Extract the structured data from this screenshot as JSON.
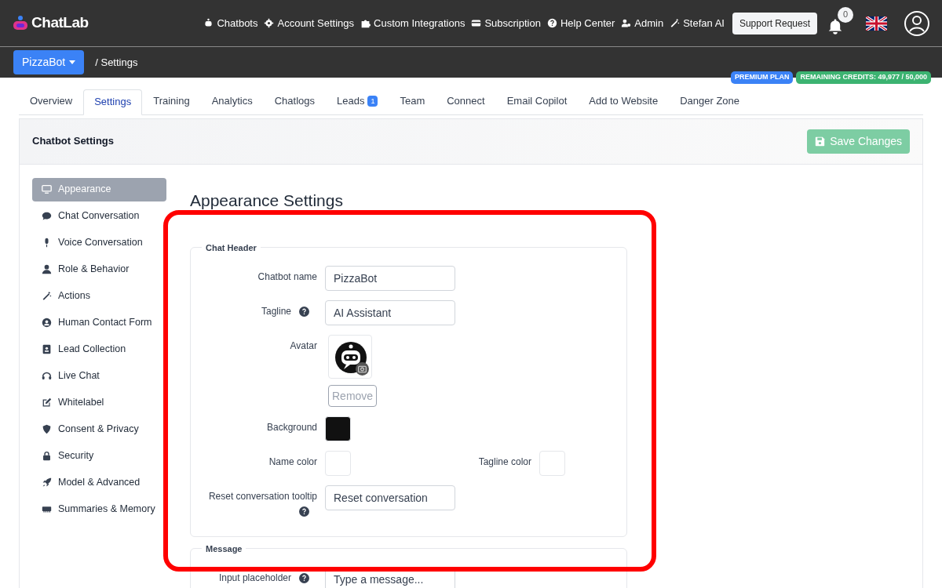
{
  "header": {
    "logo": "ChatLab",
    "nav": [
      {
        "label": "Chatbots",
        "kind": "robot"
      },
      {
        "label": "Account Settings",
        "kind": "gear"
      },
      {
        "label": "Custom Integrations",
        "kind": "puzzle"
      },
      {
        "label": "Subscription",
        "kind": "card"
      },
      {
        "label": "Help Center",
        "kind": "question"
      },
      {
        "label": "Admin",
        "kind": "user-gear"
      },
      {
        "label": "Stefan AI",
        "kind": "wand"
      }
    ],
    "support_button": "Support Request",
    "notification_count": "0"
  },
  "subbar": {
    "bot_selector": "PizzaBot",
    "breadcrumb": "/ Settings"
  },
  "badges": [
    {
      "label": "PREMIUM PLAN",
      "color": "#3b82f6"
    },
    {
      "label": "REMAINING CREDITS: 49,977 / 50,000",
      "color": "#3cb371"
    }
  ],
  "tabs": [
    {
      "label": "Overview",
      "selected": false
    },
    {
      "label": "Settings",
      "selected": true
    },
    {
      "label": "Training",
      "selected": false
    },
    {
      "label": "Analytics",
      "selected": false
    },
    {
      "label": "Chatlogs",
      "selected": false
    },
    {
      "label": "Leads",
      "selected": false,
      "count": "1"
    },
    {
      "label": "Team",
      "selected": false
    },
    {
      "label": "Connect",
      "selected": false
    },
    {
      "label": "Email Copilot",
      "selected": false
    },
    {
      "label": "Add to Website",
      "selected": false
    },
    {
      "label": "Danger Zone",
      "selected": false
    }
  ],
  "card": {
    "title": "Chatbot Settings",
    "save_button": {
      "label": "Save Changes",
      "disabled": true
    }
  },
  "sidebar": {
    "items": [
      {
        "label": "Appearance",
        "kind": "monitor",
        "selected": true
      },
      {
        "label": "Chat Conversation",
        "kind": "chat",
        "selected": false
      },
      {
        "label": "Voice Conversation",
        "kind": "mic",
        "selected": false
      },
      {
        "label": "Role & Behavior",
        "kind": "user",
        "selected": false
      },
      {
        "label": "Actions",
        "kind": "wand",
        "selected": false
      },
      {
        "label": "Human Contact Form",
        "kind": "user-circle",
        "selected": false
      },
      {
        "label": "Lead Collection",
        "kind": "contact-book",
        "selected": false
      },
      {
        "label": "Live Chat",
        "kind": "headset",
        "selected": false
      },
      {
        "label": "Whitelabel",
        "kind": "edit",
        "selected": false
      },
      {
        "label": "Consent & Privacy",
        "kind": "shield",
        "selected": false
      },
      {
        "label": "Security",
        "kind": "lock",
        "selected": false
      },
      {
        "label": "Model & Advanced",
        "kind": "rocket",
        "selected": false
      },
      {
        "label": "Summaries & Memory",
        "kind": "memory",
        "selected": false
      }
    ]
  },
  "section_title": "Appearance Settings",
  "fieldsets": [
    {
      "legend": "Chat Header",
      "fields": [
        {
          "kind": "text",
          "label": "Chatbot name",
          "value": "PizzaBot"
        },
        {
          "kind": "text",
          "label": "Tagline",
          "help": true,
          "value": "AI Assistant"
        },
        {
          "kind": "avatar",
          "label": "Avatar",
          "remove_button": "Remove"
        },
        {
          "kind": "color",
          "label": "Background",
          "color": "#111111"
        },
        {
          "kind": "color",
          "label": "Name color",
          "color": "#ffffff",
          "beside": {
            "label": "Tagline color",
            "color": "#ffffff"
          }
        },
        {
          "kind": "text",
          "label": "Reset conversation tooltip",
          "help": true,
          "help_below": true,
          "value": "Reset conversation"
        }
      ]
    },
    {
      "legend": "Message",
      "fields": [
        {
          "kind": "text",
          "label": "Input placeholder",
          "help": true,
          "placeholder": "Type a message..."
        }
      ]
    }
  ]
}
